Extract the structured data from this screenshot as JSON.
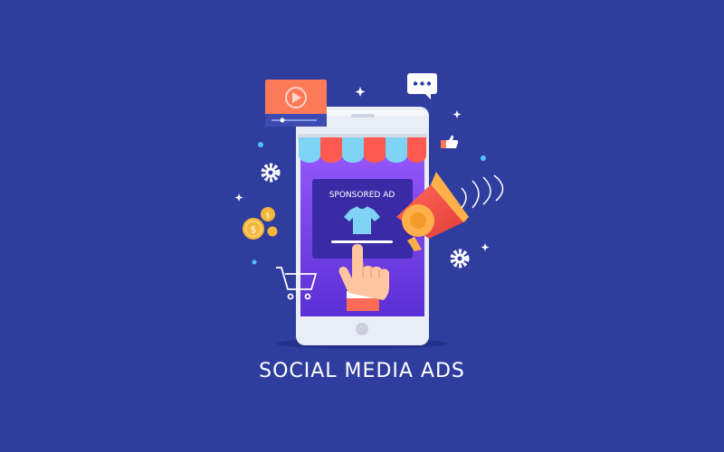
{
  "illustration": {
    "title": "SOCIAL MEDIA ADS",
    "ad_label": "SPONSORED AD"
  },
  "colors": {
    "background": "#2f3e9e",
    "phone_body": "#e9edf5",
    "screen_top": "#8b4dff",
    "screen_bottom": "#5b2fd6",
    "awning_blue": "#7fd3f4",
    "awning_red": "#ff5a4f",
    "megaphone": "#ff5a4f",
    "coin": "#f4b63a",
    "video_card": "#ff7a59"
  },
  "icons": [
    "video-player-icon",
    "chat-bubble-icon",
    "thumbs-up-icon",
    "gear-icon",
    "megaphone-icon",
    "coin-icon",
    "shopping-cart-icon",
    "tshirt-icon",
    "hand-pointer-icon",
    "sparkle-icon"
  ]
}
